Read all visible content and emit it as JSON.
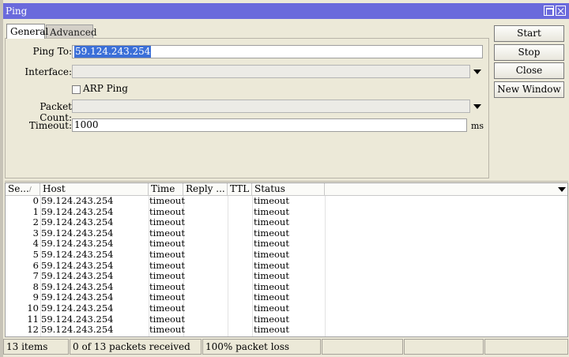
{
  "window": {
    "title": "Ping"
  },
  "tabs": [
    {
      "label": "General"
    },
    {
      "label": "Advanced"
    }
  ],
  "form": {
    "ping_to_label": "Ping To:",
    "ping_to_value": "59.124.243.254",
    "interface_label": "Interface:",
    "interface_value": "",
    "arp_ping_label": "ARP Ping",
    "packet_count_label": "Packet Count:",
    "packet_count_value": "",
    "timeout_label": "Timeout:",
    "timeout_value": "1000",
    "timeout_unit": "ms"
  },
  "buttons": {
    "start": "Start",
    "stop": "Stop",
    "close": "Close",
    "new_window": "New Window"
  },
  "table": {
    "columns": [
      "Se...",
      "Host",
      "Time",
      "Reply ...",
      "TTL",
      "Status"
    ],
    "rows": [
      {
        "seq": "0",
        "host": "59.124.243.254",
        "time": "timeout",
        "status": "timeout"
      },
      {
        "seq": "1",
        "host": "59.124.243.254",
        "time": "timeout",
        "status": "timeout"
      },
      {
        "seq": "2",
        "host": "59.124.243.254",
        "time": "timeout",
        "status": "timeout"
      },
      {
        "seq": "3",
        "host": "59.124.243.254",
        "time": "timeout",
        "status": "timeout"
      },
      {
        "seq": "4",
        "host": "59.124.243.254",
        "time": "timeout",
        "status": "timeout"
      },
      {
        "seq": "5",
        "host": "59.124.243.254",
        "time": "timeout",
        "status": "timeout"
      },
      {
        "seq": "6",
        "host": "59.124.243.254",
        "time": "timeout",
        "status": "timeout"
      },
      {
        "seq": "7",
        "host": "59.124.243.254",
        "time": "timeout",
        "status": "timeout"
      },
      {
        "seq": "8",
        "host": "59.124.243.254",
        "time": "timeout",
        "status": "timeout"
      },
      {
        "seq": "9",
        "host": "59.124.243.254",
        "time": "timeout",
        "status": "timeout"
      },
      {
        "seq": "10",
        "host": "59.124.243.254",
        "time": "timeout",
        "status": "timeout"
      },
      {
        "seq": "11",
        "host": "59.124.243.254",
        "time": "timeout",
        "status": "timeout"
      },
      {
        "seq": "12",
        "host": "59.124.243.254",
        "time": "timeout",
        "status": "timeout"
      }
    ]
  },
  "status": {
    "items": "13 items",
    "received": "0 of 13 packets received",
    "loss": "100% packet loss"
  },
  "colors": {
    "titlebar": "#6a6adc",
    "window_bg": "#ece9d8",
    "selection": "#3b6fd8"
  }
}
